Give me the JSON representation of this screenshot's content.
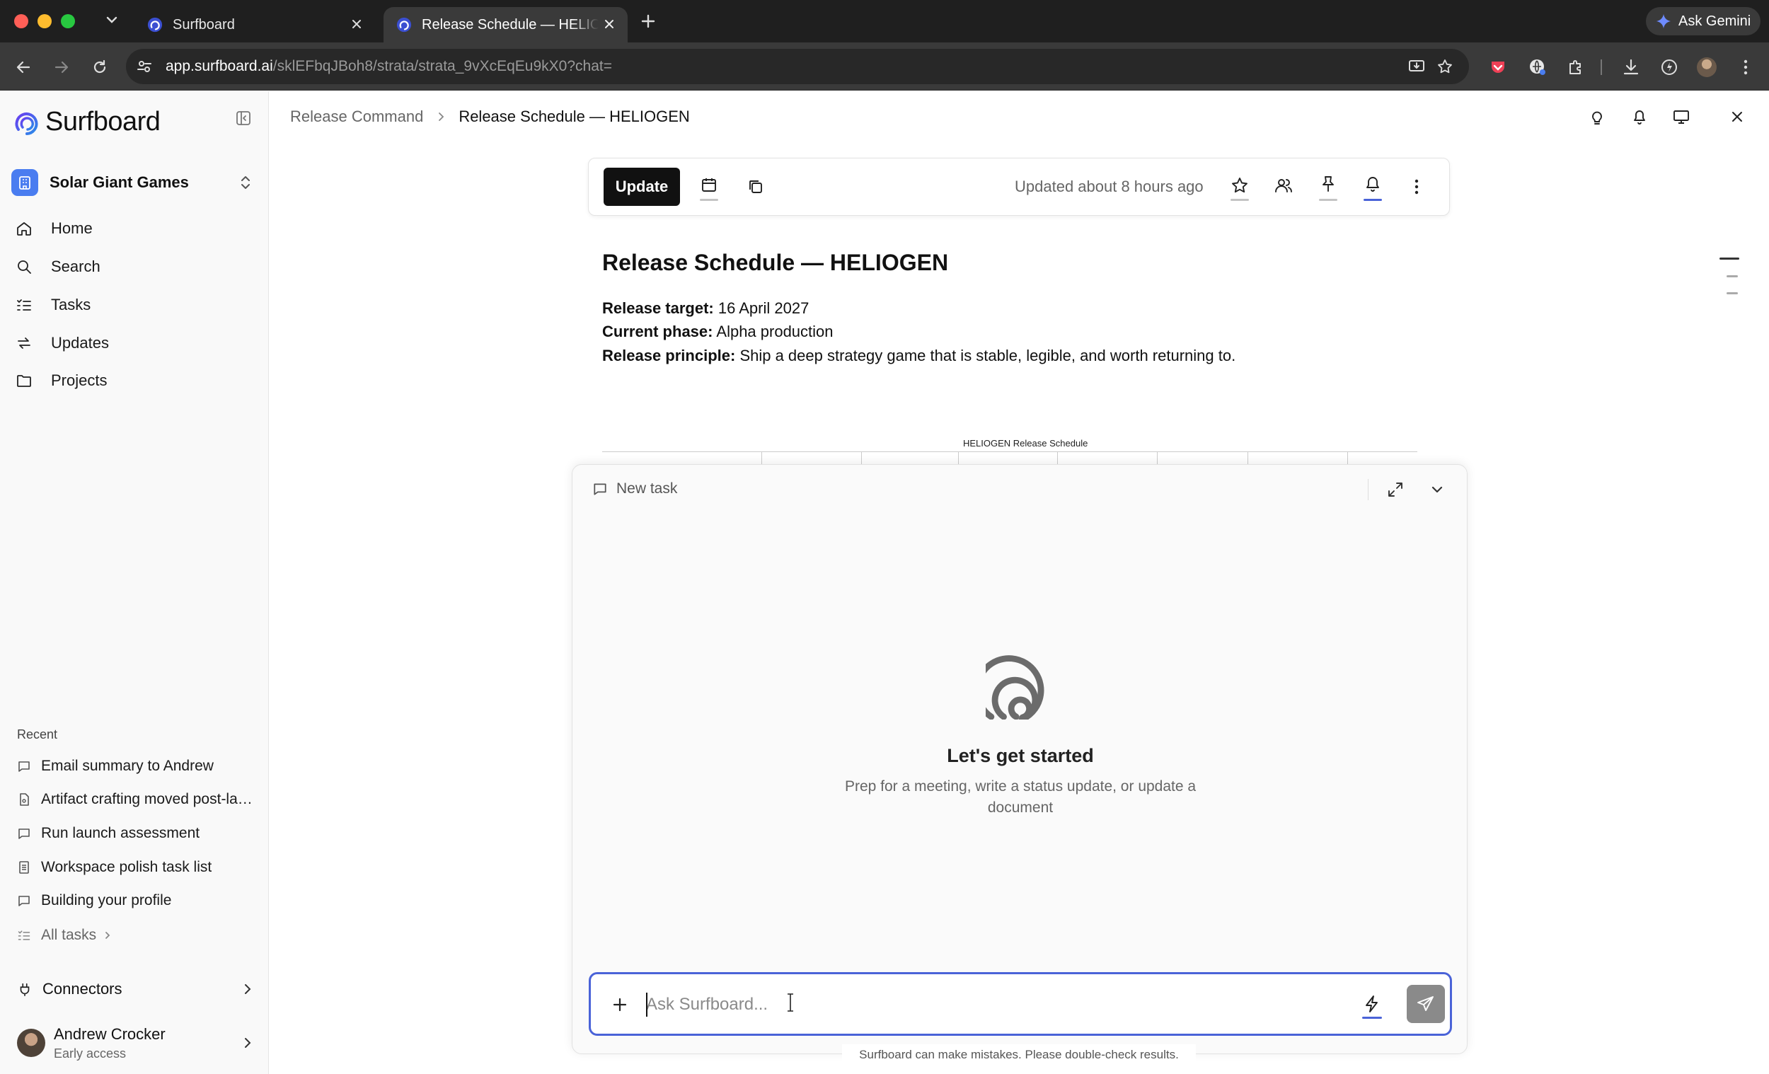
{
  "browser": {
    "tabs": [
      {
        "title": "Surfboard",
        "active": false
      },
      {
        "title": "Release Schedule — HELIOGEN",
        "active": true
      }
    ],
    "url_host": "app.surfboard.ai",
    "url_path": "/sklEFbqJBoh8/strata/strata_9vXcEqEu9kX0?chat=",
    "ask_gemini_label": "Ask Gemini"
  },
  "sidebar": {
    "brand": "Surfboard",
    "workspace": "Solar Giant Games",
    "nav": [
      {
        "label": "Home",
        "icon": "home-icon"
      },
      {
        "label": "Search",
        "icon": "search-icon"
      },
      {
        "label": "Tasks",
        "icon": "tasks-icon"
      },
      {
        "label": "Updates",
        "icon": "updates-icon"
      },
      {
        "label": "Projects",
        "icon": "folder-icon"
      }
    ],
    "recent_heading": "Recent",
    "recent": [
      {
        "label": "Email summary to Andrew",
        "icon": "chat-icon"
      },
      {
        "label": "Artifact crafting moved post-launch",
        "icon": "document-icon"
      },
      {
        "label": "Run launch assessment",
        "icon": "chat-icon"
      },
      {
        "label": "Workspace polish task list",
        "icon": "list-doc-icon"
      },
      {
        "label": "Building your profile",
        "icon": "chat-icon"
      }
    ],
    "all_tasks": "All tasks",
    "connectors": "Connectors",
    "user": {
      "name": "Andrew Crocker",
      "subtitle": "Early access"
    }
  },
  "header": {
    "breadcrumb_parent": "Release Command",
    "breadcrumb_current": "Release Schedule — HELIOGEN"
  },
  "doc_toolbar": {
    "update_label": "Update",
    "updated_text": "Updated about 8 hours ago",
    "notification_accent": "#4a63d8"
  },
  "document": {
    "title": "Release Schedule — HELIOGEN",
    "fields": [
      {
        "label": "Release target:",
        "value": "16 April 2027"
      },
      {
        "label": "Current phase:",
        "value": "Alpha production"
      },
      {
        "label": "Release principle:",
        "value": "Ship a deep strategy game that is stable, legible, and worth returning to."
      }
    ],
    "embedded_chart_title": "HELIOGEN Release Schedule"
  },
  "chat": {
    "header_label": "New task",
    "empty_title": "Let's get started",
    "empty_subtitle": "Prep for a meeting, write a status update, or update a document",
    "input_placeholder": "Ask Surfboard...",
    "input_value": "",
    "disclaimer": "Surfboard can make mistakes. Please double-check results.",
    "accent": "#4a63d8"
  }
}
